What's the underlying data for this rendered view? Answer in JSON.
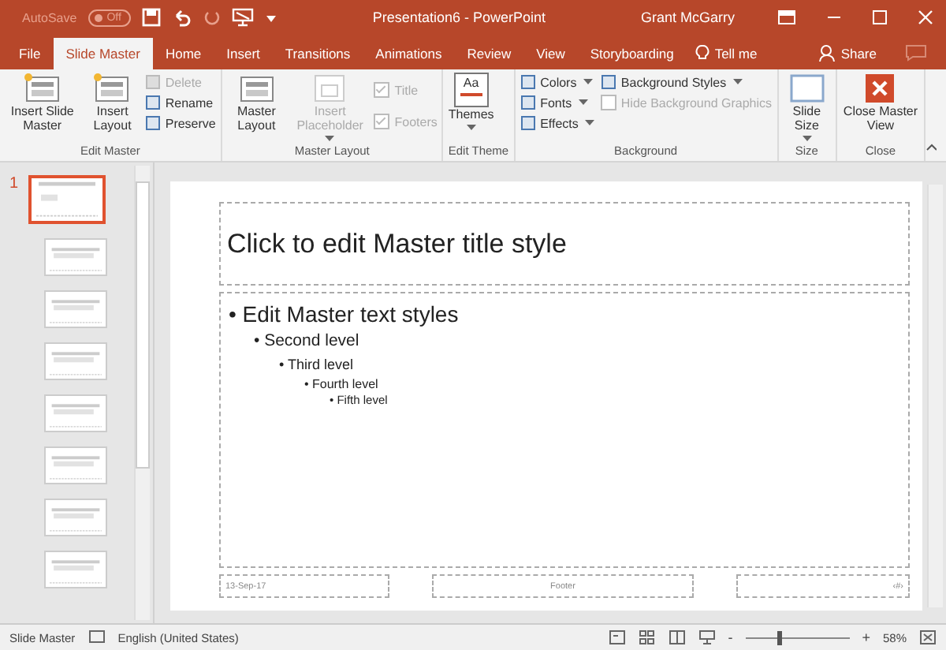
{
  "title_bar": {
    "autosave_label": "AutoSave",
    "autosave_toggle": {
      "label": "Off",
      "on": false
    },
    "title": "Presentation6  -  PowerPoint",
    "user": "Grant McGarry"
  },
  "tabs": [
    {
      "label": "File",
      "selected": false
    },
    {
      "label": "Slide Master",
      "selected": true
    },
    {
      "label": "Home",
      "selected": false
    },
    {
      "label": "Insert",
      "selected": false
    },
    {
      "label": "Transitions",
      "selected": false
    },
    {
      "label": "Animations",
      "selected": false
    },
    {
      "label": "Review",
      "selected": false
    },
    {
      "label": "View",
      "selected": false
    },
    {
      "label": "Storyboarding",
      "selected": false
    }
  ],
  "tell_me": "Tell me",
  "share": "Share",
  "ribbon": [
    {
      "label": "Edit Master",
      "items": [
        {
          "kind": "large",
          "label": "Insert Slide Master",
          "disabled": false
        },
        {
          "kind": "large",
          "label": "Insert Layout",
          "disabled": false
        },
        {
          "kind": "stack",
          "items": [
            {
              "kind": "command",
              "label": "Delete",
              "disabled": true
            },
            {
              "kind": "command",
              "label": "Rename",
              "disabled": false
            },
            {
              "kind": "command",
              "label": "Preserve",
              "disabled": false
            }
          ]
        }
      ]
    },
    {
      "label": "Master Layout",
      "items": [
        {
          "kind": "large",
          "label": "Master Layout",
          "disabled": false
        },
        {
          "kind": "large",
          "label": "Insert Placeholder",
          "disabled": true,
          "dropdown": true
        },
        {
          "kind": "checks",
          "items": [
            {
              "label": "Title",
              "checked": true,
              "disabled": true
            },
            {
              "label": "Footers",
              "checked": true,
              "disabled": true
            }
          ]
        }
      ]
    },
    {
      "label": "Edit Theme",
      "items": [
        {
          "kind": "large",
          "label": "Themes",
          "icon_text": "Aa",
          "disabled": false,
          "dropdown": true
        }
      ]
    },
    {
      "label": "Background",
      "items": [
        {
          "kind": "stack",
          "items": [
            {
              "kind": "command",
              "label": "Colors",
              "disabled": false,
              "dropdown": true
            },
            {
              "kind": "command",
              "label": "Fonts",
              "disabled": false,
              "dropdown": true
            },
            {
              "kind": "command",
              "label": "Effects",
              "disabled": false,
              "dropdown": true
            }
          ]
        },
        {
          "kind": "stack",
          "items": [
            {
              "kind": "command",
              "label": "Background Styles",
              "disabled": false,
              "dropdown": true
            },
            {
              "kind": "checkbox",
              "label": "Hide Background Graphics",
              "disabled": true,
              "checked": false
            }
          ]
        }
      ]
    },
    {
      "label": "Size",
      "items": [
        {
          "kind": "large",
          "label": "Slide Size",
          "disabled": false,
          "dropdown": true
        }
      ]
    },
    {
      "label": "Close",
      "items": [
        {
          "kind": "large",
          "label": "Close Master View",
          "disabled": false
        }
      ]
    }
  ],
  "thumbnails": [
    {
      "number": "1",
      "selected": true,
      "children": [
        {
          "selected": false
        },
        {
          "selected": false
        },
        {
          "selected": false
        },
        {
          "selected": false
        },
        {
          "selected": false
        },
        {
          "selected": false
        },
        {
          "selected": false
        }
      ]
    }
  ],
  "slide": {
    "title": "Click to edit Master title style",
    "body": [
      {
        "bullet": "•",
        "text": "Edit Master text styles",
        "children": [
          {
            "bullet": "•",
            "text": "Second level",
            "children": [
              {
                "bullet": "•",
                "text": "Third level",
                "children": [
                  {
                    "bullet": "•",
                    "text": "Fourth level",
                    "children": [
                      {
                        "bullet": "•",
                        "text": "Fifth level"
                      }
                    ]
                  }
                ]
              }
            ]
          }
        ]
      }
    ],
    "date": "13-Sep-17",
    "footer": "Footer",
    "number": "‹#›"
  },
  "status_bar": {
    "mode": "Slide Master",
    "language": "English (United States)",
    "zoom_out": "-",
    "zoom_slider": {
      "level": 0.3
    },
    "zoom_in": "+",
    "zoom": "58%"
  }
}
